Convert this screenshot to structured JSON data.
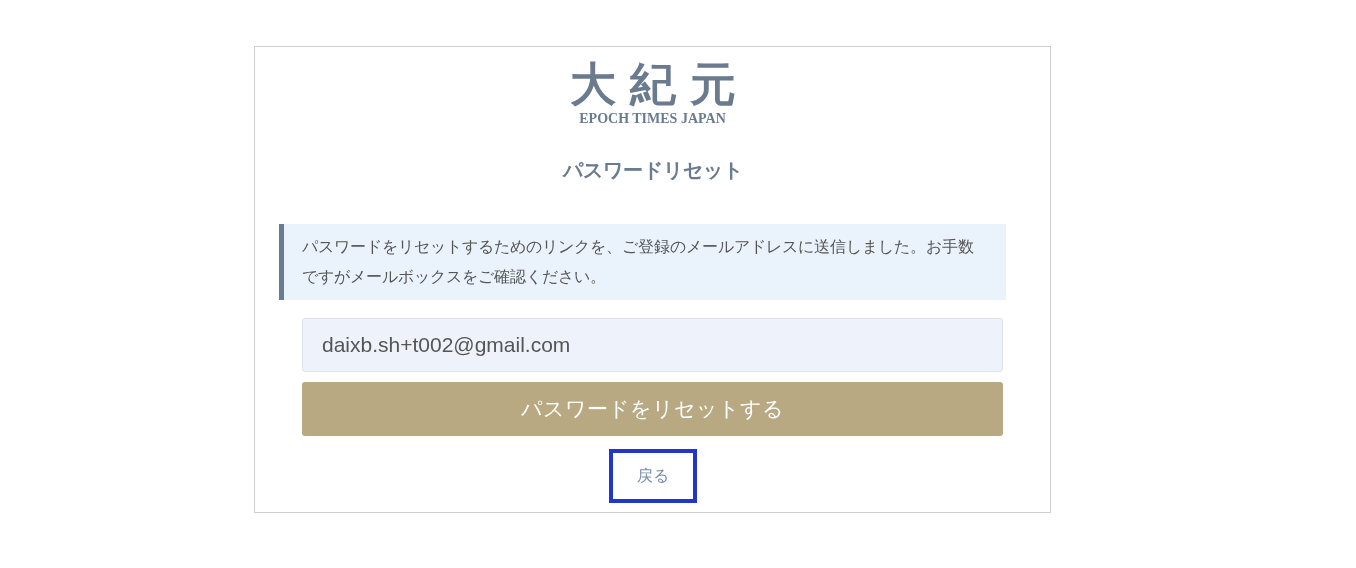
{
  "logo": {
    "mark": "大紀元",
    "subtitle": "EPOCH TIMES JAPAN"
  },
  "title": "パスワードリセット",
  "notice": "パスワードをリセットするためのリンクを、ご登録のメールアドレスに送信しました。お手数ですがメールボックスをご確認ください。",
  "email_field": {
    "value": "daixb.sh+t002@gmail.com"
  },
  "submit_button": "パスワードをリセットする",
  "back_link": {
    "label": "戻る",
    "focused": true
  }
}
